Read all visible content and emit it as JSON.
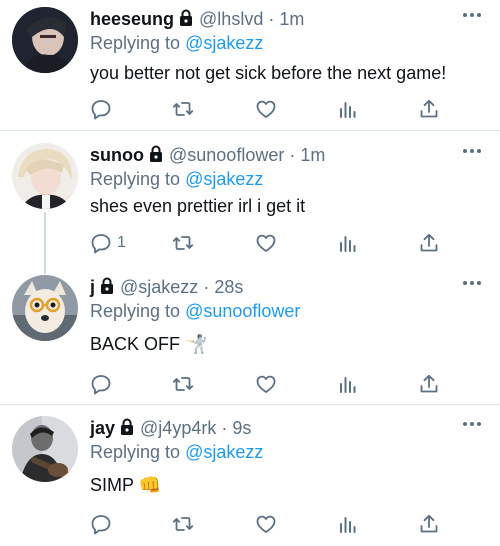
{
  "tweets": [
    {
      "name": "heeseung",
      "handle": "@lhslvd",
      "time": "1m",
      "replying_label": "Replying to",
      "replying_to": "@sjakezz",
      "text": "you better not get sick before the next game!",
      "reply_count": ""
    },
    {
      "name": "sunoo",
      "handle": "@sunooflower",
      "time": "1m",
      "replying_label": "Replying to",
      "replying_to": "@sjakezz",
      "text": "shes even prettier irl i get it",
      "reply_count": "1"
    },
    {
      "name": "j",
      "handle": "@sjakezz",
      "time": "28s",
      "replying_label": "Replying to",
      "replying_to": "@sunooflower",
      "text": "BACK OFF 🤺",
      "reply_count": ""
    },
    {
      "name": "jay",
      "handle": "@j4yp4rk",
      "time": "9s",
      "replying_label": "Replying to",
      "replying_to": "@sjakezz",
      "text": "SIMP 👊",
      "reply_count": ""
    }
  ],
  "separator": "·",
  "icons": [
    "lock-icon",
    "more-icon",
    "reply-icon",
    "retweet-icon",
    "like-icon",
    "analytics-icon",
    "share-icon"
  ],
  "colors": {
    "mention": "#1d9bf0",
    "secondary_text": "#5b7083",
    "primary_text": "#0f1419",
    "divider": "#e1e6ea"
  }
}
